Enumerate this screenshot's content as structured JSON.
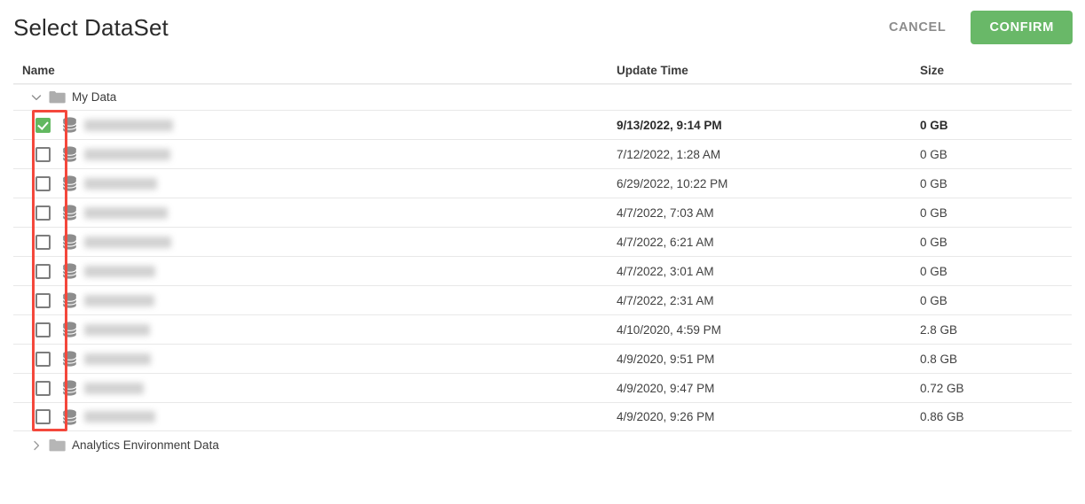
{
  "dialog": {
    "title": "Select DataSet",
    "cancel_label": "CANCEL",
    "confirm_label": "CONFIRM",
    "confirm_color": "#69b868",
    "cancel_color": "#8c8c8c"
  },
  "columns": {
    "name": "Name",
    "update_time": "Update Time",
    "size": "Size"
  },
  "tree": {
    "expanded_folder": {
      "label": "My Data",
      "icon": "folder-icon",
      "chevron": "chevron-down-icon",
      "expanded": true
    },
    "collapsed_folder": {
      "label": "Analytics Environment Data",
      "icon": "folder-icon",
      "chevron": "chevron-right-icon",
      "expanded": false
    }
  },
  "rows": [
    {
      "icon": "database-icon",
      "name_redacted": true,
      "name_width": 100,
      "checked": true,
      "update_time": "9/13/2022, 9:14 PM",
      "size": "0 GB"
    },
    {
      "icon": "database-icon",
      "name_redacted": true,
      "name_width": 97,
      "checked": false,
      "update_time": "7/12/2022, 1:28 AM",
      "size": "0 GB"
    },
    {
      "icon": "database-icon",
      "name_redacted": true,
      "name_width": 82,
      "checked": false,
      "update_time": "6/29/2022, 10:22 PM",
      "size": "0 GB"
    },
    {
      "icon": "database-icon",
      "name_redacted": true,
      "name_width": 94,
      "checked": false,
      "update_time": "4/7/2022, 7:03 AM",
      "size": "0 GB"
    },
    {
      "icon": "database-icon",
      "name_redacted": true,
      "name_width": 98,
      "checked": false,
      "update_time": "4/7/2022, 6:21 AM",
      "size": "0 GB"
    },
    {
      "icon": "database-icon",
      "name_redacted": true,
      "name_width": 80,
      "checked": false,
      "update_time": "4/7/2022, 3:01 AM",
      "size": "0 GB"
    },
    {
      "icon": "database-icon",
      "name_redacted": true,
      "name_width": 79,
      "checked": false,
      "update_time": "4/7/2022, 2:31 AM",
      "size": "0 GB"
    },
    {
      "icon": "database-icon",
      "name_redacted": true,
      "name_width": 74,
      "checked": false,
      "update_time": "4/10/2020, 4:59 PM",
      "size": "2.8 GB"
    },
    {
      "icon": "database-icon",
      "name_redacted": true,
      "name_width": 75,
      "checked": false,
      "update_time": "4/9/2020, 9:51 PM",
      "size": "0.8 GB"
    },
    {
      "icon": "database-icon",
      "name_redacted": true,
      "name_width": 67,
      "checked": false,
      "update_time": "4/9/2020, 9:47 PM",
      "size": "0.72 GB"
    },
    {
      "icon": "database-icon",
      "name_redacted": true,
      "name_width": 80,
      "checked": false,
      "update_time": "4/9/2020, 9:26 PM",
      "size": "0.86 GB"
    }
  ],
  "annotation": {
    "shape": "rectangle",
    "color": "#f4483c",
    "target": "checkbox-column"
  }
}
